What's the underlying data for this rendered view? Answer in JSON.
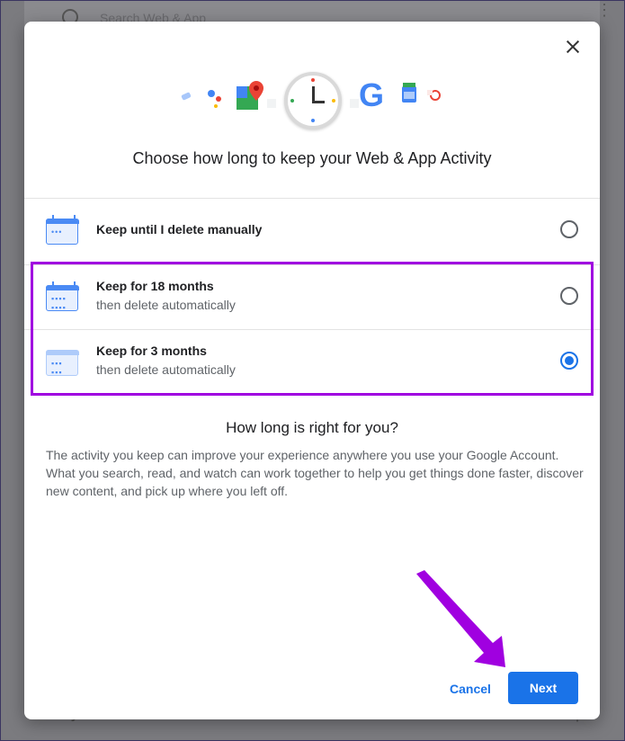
{
  "background": {
    "search_placeholder": "Search Web & App",
    "section_label": "Today"
  },
  "dialog": {
    "title": "Choose how long to keep your Web & App Activity",
    "brand_letter": "G",
    "options": [
      {
        "title": "Keep until I delete manually",
        "subtitle": "",
        "selected": false,
        "icon": "calendar-icon"
      },
      {
        "title": "Keep for 18 months",
        "subtitle": "then delete automatically",
        "selected": false,
        "icon": "calendar-grid-icon"
      },
      {
        "title": "Keep for 3 months",
        "subtitle": "then delete automatically",
        "selected": true,
        "icon": "calendar-stack-icon"
      }
    ],
    "info_title": "How long is right for you?",
    "info_text": "The activity you keep can improve your experience anywhere you use your Google Account. What you search, read, and watch can work together to help you get things done faster, discover new content, and pick up where you left off.",
    "cancel_label": "Cancel",
    "next_label": "Next"
  },
  "colors": {
    "accent": "#1a73e8",
    "highlight": "#a000e0"
  }
}
